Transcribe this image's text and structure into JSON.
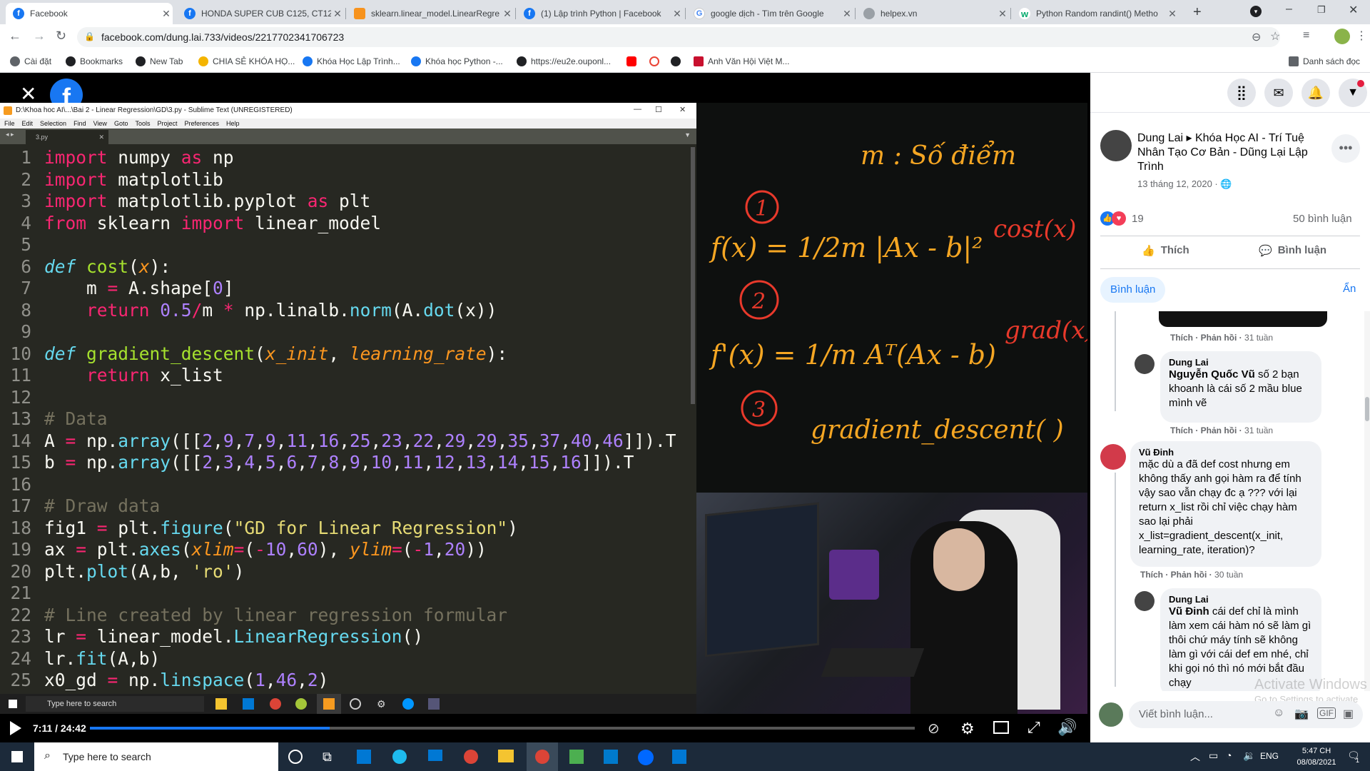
{
  "browser": {
    "tabs": [
      {
        "label": "Facebook",
        "active": true,
        "icon": "facebook-icon"
      },
      {
        "label": "HONDA SUPER CUB C125, CT12",
        "icon": "facebook-icon"
      },
      {
        "label": "sklearn.linear_model.LinearRegre",
        "icon": "sklearn-icon"
      },
      {
        "label": "(1) Lập trình Python | Facebook",
        "icon": "facebook-icon"
      },
      {
        "label": "google dịch - Tìm trên Google",
        "icon": "google-icon"
      },
      {
        "label": "helpex.vn",
        "icon": "globe-icon"
      },
      {
        "label": "Python Random randint() Metho",
        "icon": "w3schools-icon"
      }
    ],
    "url": "facebook.com/dung.lai.733/videos/2217702341706723",
    "bookmarks": [
      {
        "label": "Cài đặt",
        "icon": "gear-icon"
      },
      {
        "label": "Bookmarks",
        "icon": "star-icon"
      },
      {
        "label": "New Tab",
        "icon": "github-icon"
      },
      {
        "label": "CHIA SẺ KHÓA HỌ...",
        "icon": "drive-icon"
      },
      {
        "label": "Khóa Học Lập Trình...",
        "icon": "facebook-icon"
      },
      {
        "label": "Khóa học Python -...",
        "icon": "facebook-icon"
      },
      {
        "label": "https://eu2e.ouponl...",
        "icon": "github-icon"
      },
      {
        "label": "",
        "icon": "youtube-icon"
      },
      {
        "label": "",
        "icon": "google-icon"
      },
      {
        "label": "",
        "icon": "github-icon"
      },
      {
        "label": "Anh Văn Hội Việt M...",
        "icon": "vus-icon"
      }
    ],
    "reading_list": "Danh sách đọc"
  },
  "sublime": {
    "title": "D:\\Khoa hoc AI\\...\\Bai 2 - Linear Regression\\GD\\3.py - Sublime Text (UNREGISTERED)",
    "menu": [
      "File",
      "Edit",
      "Selection",
      "Find",
      "View",
      "Goto",
      "Tools",
      "Project",
      "Preferences",
      "Help"
    ],
    "tab": "3.py",
    "code": [
      {
        "n": "1",
        "html": "<span class='k'>import</span> numpy <span class='k'>as</span> np"
      },
      {
        "n": "2",
        "html": "<span class='k'>import</span> matplotlib"
      },
      {
        "n": "3",
        "html": "<span class='k'>import</span> matplotlib.pyplot <span class='k'>as</span> plt"
      },
      {
        "n": "4",
        "html": "<span class='k'>from</span> sklearn <span class='k'>import</span> linear_model"
      },
      {
        "n": "5",
        "html": ""
      },
      {
        "n": "6",
        "html": "<span class='d'>def</span> <span class='f'>cost</span>(<span class='a'>x</span>):"
      },
      {
        "n": "7",
        "html": "    m <span class='k'>=</span> A.shape[<span class='n'>0</span>]"
      },
      {
        "n": "8",
        "html": "    <span class='k'>return</span> <span class='n'>0.5</span><span class='k'>/</span>m <span class='k'>*</span> np.linalb.<span class='bn'>norm</span>(A.<span class='bn'>dot</span>(x))"
      },
      {
        "n": "9",
        "html": ""
      },
      {
        "n": "10",
        "html": "<span class='d'>def</span> <span class='f'>gradient_descent</span>(<span class='a'>x_init</span>, <span class='a'>learning_rate</span>):"
      },
      {
        "n": "11",
        "html": "    <span class='k'>return</span> x_list"
      },
      {
        "n": "12",
        "html": ""
      },
      {
        "n": "13",
        "html": "<span class='c'># Data</span>"
      },
      {
        "n": "14",
        "html": "A <span class='k'>=</span> np.<span class='bn'>array</span>([[<span class='n'>2</span>,<span class='n'>9</span>,<span class='n'>7</span>,<span class='n'>9</span>,<span class='n'>11</span>,<span class='n'>16</span>,<span class='n'>25</span>,<span class='n'>23</span>,<span class='n'>22</span>,<span class='n'>29</span>,<span class='n'>29</span>,<span class='n'>35</span>,<span class='n'>37</span>,<span class='n'>40</span>,<span class='n'>46</span>]]).T"
      },
      {
        "n": "15",
        "html": "b <span class='k'>=</span> np.<span class='bn'>array</span>([[<span class='n'>2</span>,<span class='n'>3</span>,<span class='n'>4</span>,<span class='n'>5</span>,<span class='n'>6</span>,<span class='n'>7</span>,<span class='n'>8</span>,<span class='n'>9</span>,<span class='n'>10</span>,<span class='n'>11</span>,<span class='n'>12</span>,<span class='n'>13</span>,<span class='n'>14</span>,<span class='n'>15</span>,<span class='n'>16</span>]]).T"
      },
      {
        "n": "16",
        "html": ""
      },
      {
        "n": "17",
        "html": "<span class='c'># Draw data</span>"
      },
      {
        "n": "18",
        "html": "fig1 <span class='k'>=</span> plt.<span class='bn'>figure</span>(<span class='s'>\"GD for Linear Regression\"</span>)"
      },
      {
        "n": "19",
        "html": "ax <span class='k'>=</span> plt.<span class='bn'>axes</span>(<span class='a'>xlim</span><span class='k'>=</span>(<span class='k'>-</span><span class='n'>10</span>,<span class='n'>60</span>), <span class='a'>ylim</span><span class='k'>=</span>(<span class='k'>-</span><span class='n'>1</span>,<span class='n'>20</span>))"
      },
      {
        "n": "20",
        "html": "plt.<span class='bn'>plot</span>(A,b, <span class='s'>'ro'</span>)"
      },
      {
        "n": "21",
        "html": ""
      },
      {
        "n": "22",
        "html": "<span class='c'># Line created by linear regression formular</span>"
      },
      {
        "n": "23",
        "html": "lr <span class='k'>=</span> linear_model.<span class='bn'>LinearRegression</span>()"
      },
      {
        "n": "24",
        "html": "lr.<span class='bn'>fit</span>(A,b)"
      },
      {
        "n": "25",
        "html": "x0_gd <span class='k'>=</span> np.<span class='bn'>linspace</span>(<span class='n'>1</span>,<span class='n'>46</span>,<span class='n'>2</span>)"
      }
    ]
  },
  "whiteboard": {
    "title": "m : Số điểm",
    "f1": "f(x) = 1/2m |Ax - b|²",
    "f1_label": "cost(x)",
    "f2": "f'(x) = 1/m Aᵀ(Ax - b)",
    "f2_label": "grad(x)",
    "f3": "gradient_descent( )",
    "nums": [
      "1",
      "2",
      "3"
    ]
  },
  "inner_taskbar": {
    "search": "Type here to search"
  },
  "player": {
    "time": "7:11 / 24:42",
    "progress": 0.291
  },
  "windows": {
    "search": "Type here to search",
    "lang": "ENG",
    "time": "5:47 CH",
    "date": "08/08/2021",
    "notif": "1"
  },
  "fb": {
    "author": "Dung Lai",
    "page": "Khóa Học AI - Trí Tuệ Nhân Tạo Cơ Bản - Dũng Lại Lập Trình",
    "date": "13 tháng 12, 2020 · ",
    "reactions": "19",
    "comment_count": "50 bình luận",
    "like": "Thích",
    "comment": "Bình luận",
    "comments_tab": "Bình luận",
    "hide": "Ẩn",
    "comments": [
      {
        "name": "Dung Lai",
        "tag": "Nguyễn Quốc Vũ",
        "text": "số 2 bạn khoanh là cái số 2 mầu blue mình vẽ",
        "like": "Thích",
        "reply": "Phản hồi",
        "time": "31 tuần"
      },
      {
        "name": "Vũ Đinh",
        "text": "mặc dù a đã def cost nhưng em không thấy anh gọi hàm ra để tính vậy sao vẫn chạy đc ạ ??? với lại return x_list rồi chỉ việc chạy hàm sao lại phải x_list=gradient_descent(x_init, learning_rate, iteration)?",
        "like": "Thích",
        "reply": "Phản hồi",
        "time": "30 tuần"
      },
      {
        "name": "Dung Lai",
        "tag": "Vũ Đinh",
        "text": "cái def chỉ là mình làm xem cái hàm nó sẽ làm gì thôi chứ máy tính sẽ không làm gì với cái def em nhé, chỉ khi gọi nó thì nó mới bắt đầu chạy"
      }
    ],
    "prev_meta": {
      "like": "Thích",
      "reply": "Phản hồi",
      "time": "31 tuần"
    },
    "write_comment": "Viết bình luận...",
    "activate_title": "Activate Windows",
    "activate_sub": "Go to Settings to activate Windows."
  },
  "colors": {
    "accent": "#1877f2",
    "marker": "#f5a623",
    "marker_red": "#e8392b"
  }
}
